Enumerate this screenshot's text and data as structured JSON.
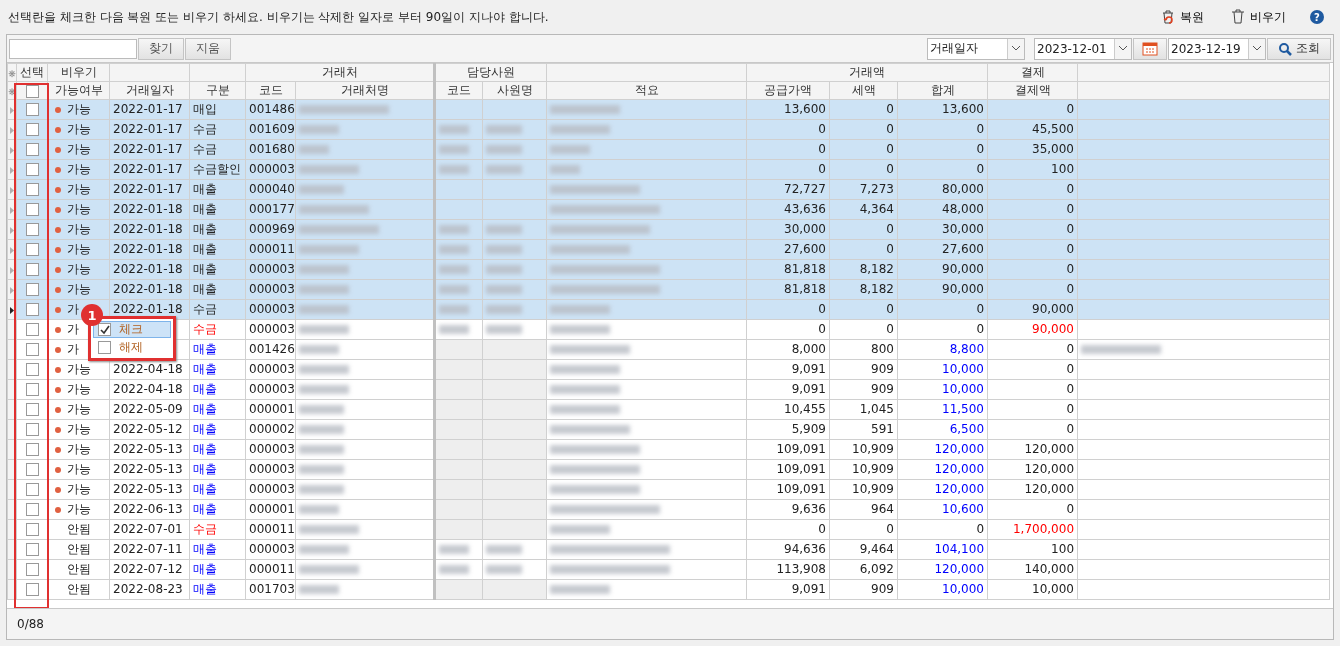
{
  "instruction": "선택란을 체크한 다음 복원 또는 비우기 하세요. 비우기는 삭제한 일자로 부터 90일이 지나야 합니다.",
  "actions": [
    {
      "label": "복원",
      "kind": "restore"
    },
    {
      "label": "비우기",
      "kind": "empty"
    }
  ],
  "help": "?",
  "search": {
    "find": "찾기",
    "clear": "지움"
  },
  "filter": {
    "field": "거래일자",
    "from": "2023-12-01",
    "to": "2023-12-19",
    "query": "조회"
  },
  "corner_marks": [
    "❋",
    "❋"
  ],
  "groups": {
    "select": "선택",
    "empty": "비우기",
    "partner": "거래처",
    "staff": "담당사원",
    "amount": "거래액",
    "payment": "결제"
  },
  "columns": {
    "possible": "가능여부",
    "date": "거래일자",
    "type": "구분",
    "code": "코드",
    "name": "거래처명",
    "staff_code": "코드",
    "staff_name": "사원명",
    "memo": "적요",
    "supply": "공급가액",
    "tax": "세액",
    "total": "합계",
    "paid": "결제액"
  },
  "select_all_checked": false,
  "rows": [
    {
      "checked": false,
      "selected": true,
      "current": false,
      "dot": true,
      "possible": "가능",
      "date": "2022-01-17",
      "type": "매입",
      "code": "001486",
      "staff_blurred": false,
      "note_blurred": false,
      "supply": "13,600",
      "tax": "0",
      "total": "13,600",
      "paid": "0"
    },
    {
      "checked": false,
      "selected": true,
      "current": false,
      "dot": true,
      "possible": "가능",
      "date": "2022-01-17",
      "type": "수금",
      "code": "001609",
      "staff_blurred": true,
      "note_blurred": false,
      "supply": "0",
      "tax": "0",
      "total": "0",
      "paid": "45,500"
    },
    {
      "checked": false,
      "selected": true,
      "current": false,
      "dot": true,
      "possible": "가능",
      "date": "2022-01-17",
      "type": "수금",
      "code": "001680",
      "staff_blurred": true,
      "note_blurred": false,
      "supply": "0",
      "tax": "0",
      "total": "0",
      "paid": "35,000"
    },
    {
      "checked": false,
      "selected": true,
      "current": false,
      "dot": true,
      "possible": "가능",
      "date": "2022-01-17",
      "type": "수금할인",
      "code": "000003",
      "staff_blurred": true,
      "note_blurred": false,
      "supply": "0",
      "tax": "0",
      "total": "0",
      "paid": "100"
    },
    {
      "checked": false,
      "selected": true,
      "current": false,
      "dot": true,
      "possible": "가능",
      "date": "2022-01-17",
      "type": "매출",
      "code": "000040",
      "staff_blurred": false,
      "note_blurred": false,
      "supply": "72,727",
      "tax": "7,273",
      "total": "80,000",
      "paid": "0"
    },
    {
      "checked": false,
      "selected": true,
      "current": false,
      "dot": true,
      "possible": "가능",
      "date": "2022-01-18",
      "type": "매출",
      "code": "000177",
      "staff_blurred": false,
      "note_blurred": false,
      "supply": "43,636",
      "tax": "4,364",
      "total": "48,000",
      "paid": "0"
    },
    {
      "checked": false,
      "selected": true,
      "current": false,
      "dot": true,
      "possible": "가능",
      "date": "2022-01-18",
      "type": "매출",
      "code": "000969",
      "staff_blurred": true,
      "note_blurred": false,
      "supply": "30,000",
      "tax": "0",
      "total": "30,000",
      "paid": "0"
    },
    {
      "checked": false,
      "selected": true,
      "current": false,
      "dot": true,
      "possible": "가능",
      "date": "2022-01-18",
      "type": "매출",
      "code": "000011",
      "staff_blurred": true,
      "note_blurred": false,
      "supply": "27,600",
      "tax": "0",
      "total": "27,600",
      "paid": "0"
    },
    {
      "checked": false,
      "selected": true,
      "current": false,
      "dot": true,
      "possible": "가능",
      "date": "2022-01-18",
      "type": "매출",
      "code": "000003",
      "staff_blurred": true,
      "note_blurred": false,
      "supply": "81,818",
      "tax": "8,182",
      "total": "90,000",
      "paid": "0"
    },
    {
      "checked": false,
      "selected": true,
      "current": false,
      "dot": true,
      "possible": "가능",
      "date": "2022-01-18",
      "type": "매출",
      "code": "000003",
      "staff_blurred": true,
      "note_blurred": false,
      "supply": "81,818",
      "tax": "8,182",
      "total": "90,000",
      "paid": "0"
    },
    {
      "checked": false,
      "selected": true,
      "current": true,
      "dot": true,
      "possible": "가",
      "date": "2022-01-18",
      "type": "수금",
      "code": "000003",
      "staff_blurred": true,
      "note_blurred": false,
      "supply": "0",
      "tax": "0",
      "total": "0",
      "paid": "90,000"
    },
    {
      "checked": false,
      "selected": false,
      "current": false,
      "dot": true,
      "possible": "가",
      "type": "수금",
      "kind": "receipt",
      "code": "000003",
      "staff_blurred": true,
      "note_blurred": false,
      "supply": "0",
      "tax": "0",
      "total": "0",
      "paid": "90,000"
    },
    {
      "checked": false,
      "selected": false,
      "current": false,
      "dot": true,
      "possible": "가",
      "type": "매출",
      "kind": "sale",
      "code": "001426",
      "staff_blurred": false,
      "note_blurred": true,
      "supply": "8,000",
      "tax": "800",
      "total": "8,800",
      "paid": "0"
    },
    {
      "checked": false,
      "selected": false,
      "current": false,
      "dot": true,
      "possible": "가능",
      "date": "2022-04-18",
      "type": "매출",
      "kind": "sale",
      "code": "000003",
      "staff_blurred": false,
      "note_blurred": false,
      "supply": "9,091",
      "tax": "909",
      "total": "10,000",
      "paid": "0"
    },
    {
      "checked": false,
      "selected": false,
      "current": false,
      "dot": true,
      "possible": "가능",
      "date": "2022-04-18",
      "type": "매출",
      "kind": "sale",
      "code": "000003",
      "staff_blurred": false,
      "note_blurred": false,
      "supply": "9,091",
      "tax": "909",
      "total": "10,000",
      "paid": "0"
    },
    {
      "checked": false,
      "selected": false,
      "current": false,
      "dot": true,
      "possible": "가능",
      "date": "2022-05-09",
      "type": "매출",
      "kind": "sale",
      "code": "000001",
      "staff_blurred": false,
      "note_blurred": false,
      "supply": "10,455",
      "tax": "1,045",
      "total": "11,500",
      "paid": "0"
    },
    {
      "checked": false,
      "selected": false,
      "current": false,
      "dot": true,
      "possible": "가능",
      "date": "2022-05-12",
      "type": "매출",
      "kind": "sale",
      "code": "000002",
      "staff_blurred": false,
      "note_blurred": false,
      "supply": "5,909",
      "tax": "591",
      "total": "6,500",
      "paid": "0"
    },
    {
      "checked": false,
      "selected": false,
      "current": false,
      "dot": true,
      "possible": "가능",
      "date": "2022-05-13",
      "type": "매출",
      "kind": "sale",
      "code": "000003",
      "staff_blurred": false,
      "note_blurred": false,
      "supply": "109,091",
      "tax": "10,909",
      "total": "120,000",
      "paid": "120,000"
    },
    {
      "checked": false,
      "selected": false,
      "current": false,
      "dot": true,
      "possible": "가능",
      "date": "2022-05-13",
      "type": "매출",
      "kind": "sale",
      "code": "000003",
      "staff_blurred": false,
      "note_blurred": false,
      "supply": "109,091",
      "tax": "10,909",
      "total": "120,000",
      "paid": "120,000"
    },
    {
      "checked": false,
      "selected": false,
      "current": false,
      "dot": true,
      "possible": "가능",
      "date": "2022-05-13",
      "type": "매출",
      "kind": "sale",
      "code": "000003",
      "staff_blurred": false,
      "note_blurred": false,
      "supply": "109,091",
      "tax": "10,909",
      "total": "120,000",
      "paid": "120,000"
    },
    {
      "checked": false,
      "selected": false,
      "current": false,
      "dot": true,
      "possible": "가능",
      "date": "2022-06-13",
      "type": "매출",
      "kind": "sale",
      "code": "000001",
      "staff_blurred": false,
      "note_blurred": false,
      "supply": "9,636",
      "tax": "964",
      "total": "10,600",
      "paid": "0"
    },
    {
      "checked": false,
      "selected": false,
      "current": false,
      "dot": false,
      "possible": "안됨",
      "date": "2022-07-01",
      "type": "수금",
      "kind": "receipt",
      "code": "000011",
      "staff_blurred": false,
      "note_blurred": false,
      "supply": "0",
      "tax": "0",
      "total": "0",
      "paid": "1,700,000"
    },
    {
      "checked": false,
      "selected": false,
      "current": false,
      "dot": false,
      "possible": "안됨",
      "date": "2022-07-11",
      "type": "매출",
      "kind": "sale",
      "code": "000003",
      "staff_blurred": true,
      "note_blurred": false,
      "supply": "94,636",
      "tax": "9,464",
      "total": "104,100",
      "paid": "100"
    },
    {
      "checked": false,
      "selected": false,
      "current": false,
      "dot": false,
      "possible": "안됨",
      "date": "2022-07-12",
      "type": "매출",
      "kind": "sale",
      "code": "000011",
      "staff_blurred": true,
      "note_blurred": false,
      "supply": "113,908",
      "tax": "6,092",
      "total": "120,000",
      "paid": "140,000"
    },
    {
      "checked": false,
      "selected": false,
      "current": false,
      "dot": false,
      "possible": "안됨",
      "date": "2022-08-23",
      "type": "매출",
      "kind": "sale",
      "code": "001703",
      "staff_blurred": false,
      "note_blurred": false,
      "supply": "9,091",
      "tax": "909",
      "total": "10,000",
      "paid": "10,000"
    }
  ],
  "context_menu": {
    "items": [
      {
        "label": "체크",
        "checked": true,
        "selected": true
      },
      {
        "label": "해제",
        "checked": false,
        "selected": false
      }
    ]
  },
  "callout": "1",
  "status": "0/88"
}
